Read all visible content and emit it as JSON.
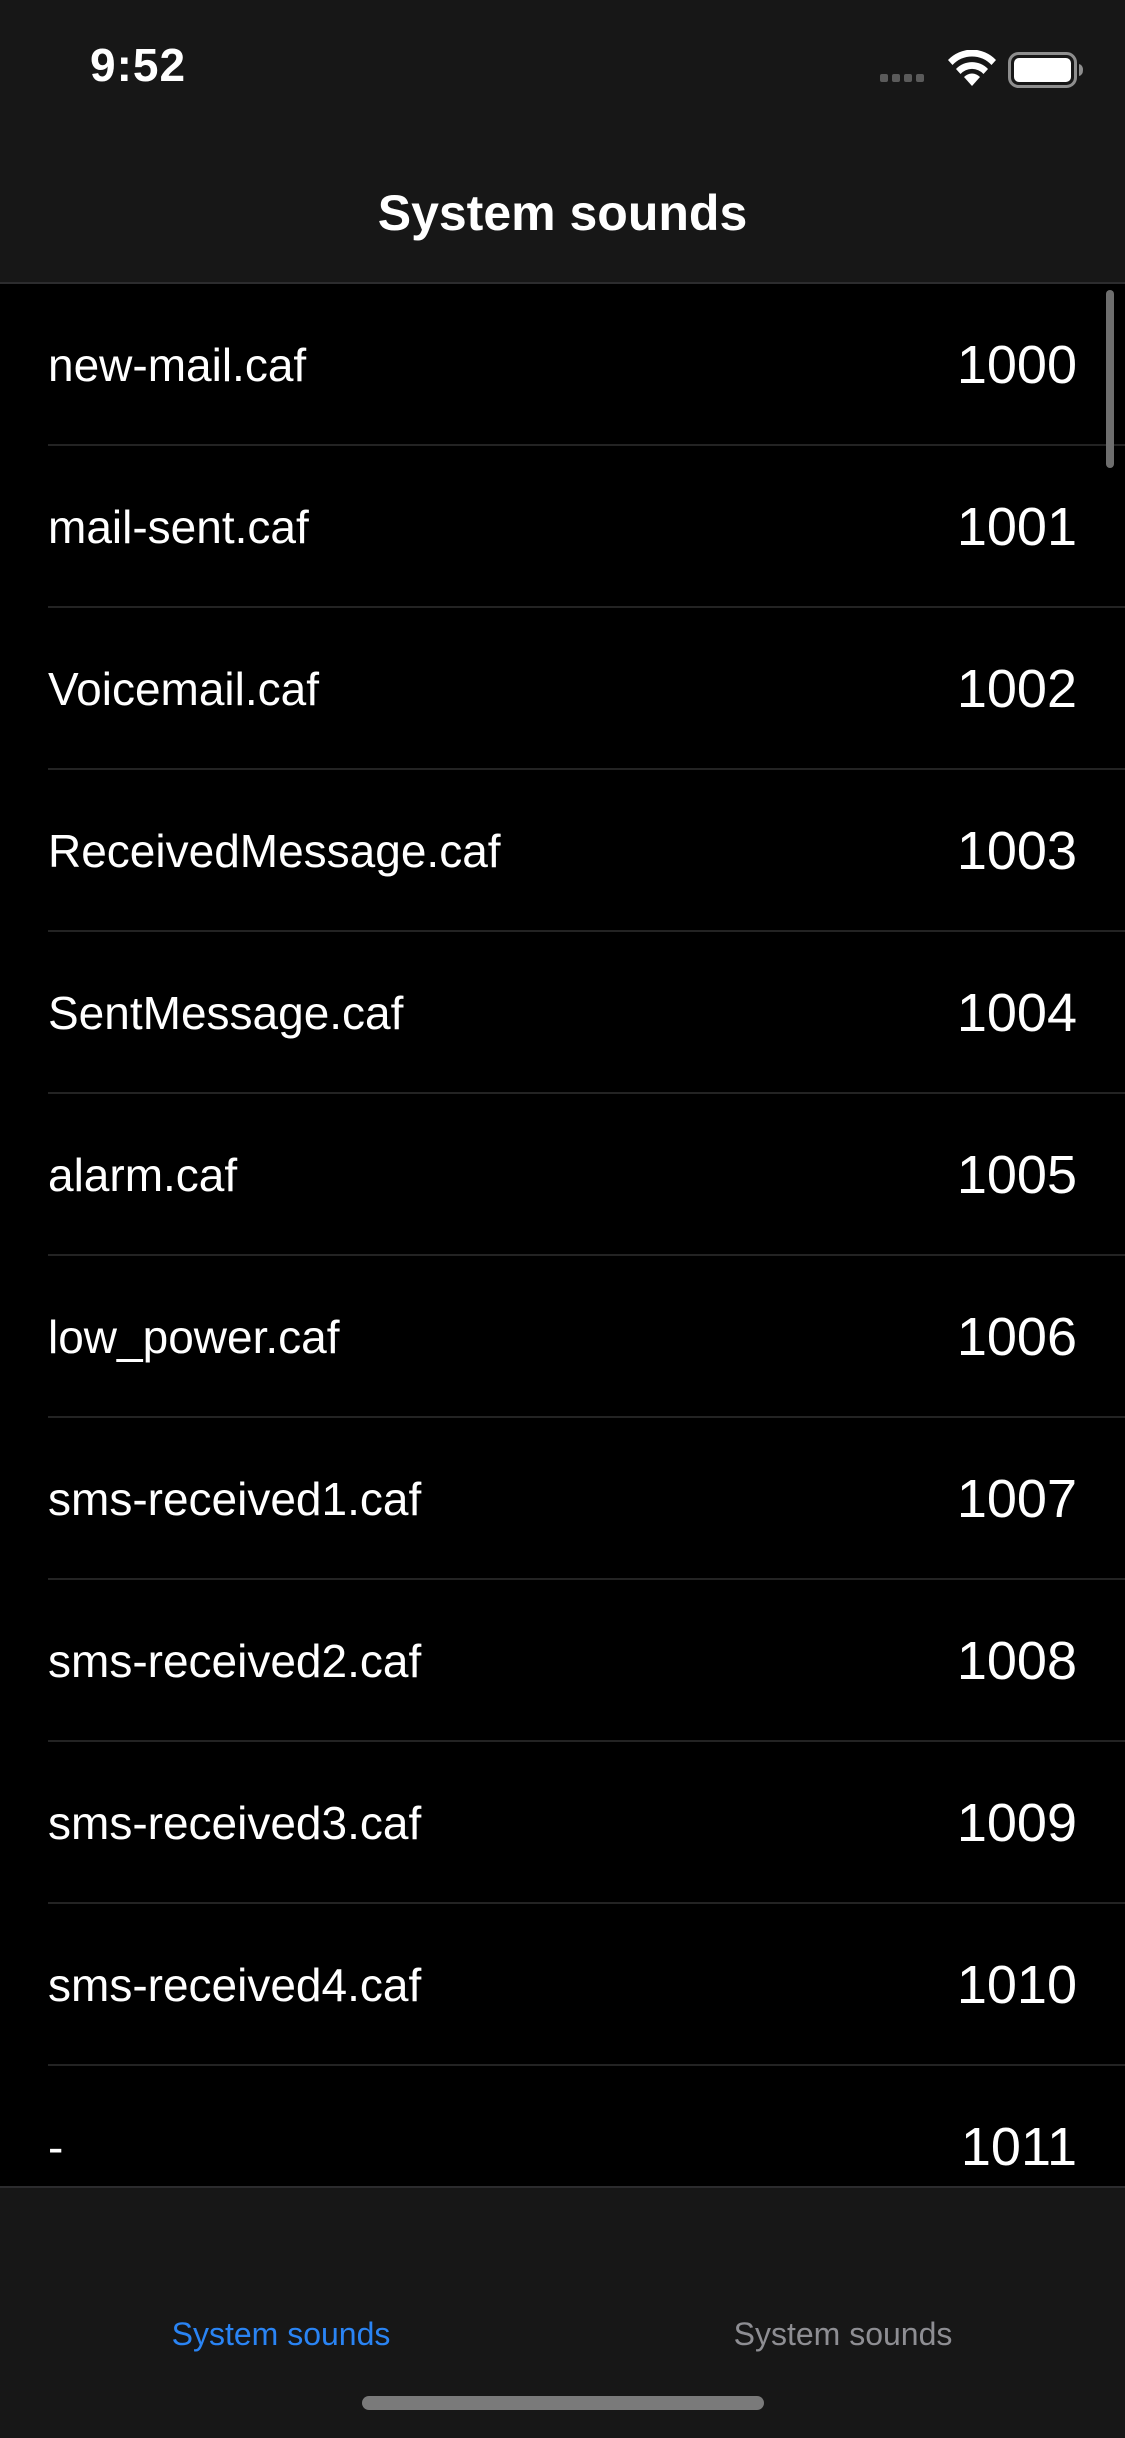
{
  "status_bar": {
    "time": "9:52",
    "icons": [
      "signal-icon",
      "wifi-icon",
      "battery-icon"
    ]
  },
  "nav": {
    "title": "System sounds"
  },
  "list": {
    "rows": [
      {
        "name": "new-mail.caf",
        "id": "1000"
      },
      {
        "name": "mail-sent.caf",
        "id": "1001"
      },
      {
        "name": "Voicemail.caf",
        "id": "1002"
      },
      {
        "name": "ReceivedMessage.caf",
        "id": "1003"
      },
      {
        "name": "SentMessage.caf",
        "id": "1004"
      },
      {
        "name": "alarm.caf",
        "id": "1005"
      },
      {
        "name": "low_power.caf",
        "id": "1006"
      },
      {
        "name": "sms-received1.caf",
        "id": "1007"
      },
      {
        "name": "sms-received2.caf",
        "id": "1008"
      },
      {
        "name": "sms-received3.caf",
        "id": "1009"
      },
      {
        "name": "sms-received4.caf",
        "id": "1010"
      },
      {
        "name": "-",
        "id": "1011"
      }
    ]
  },
  "tab_bar": {
    "tabs": [
      {
        "label": "System sounds",
        "active": true
      },
      {
        "label": "System sounds",
        "active": false
      }
    ]
  },
  "colors": {
    "background": "#000000",
    "bar_background": "#171717",
    "accent": "#2a84f4",
    "inactive_tab": "#8e8e93"
  }
}
